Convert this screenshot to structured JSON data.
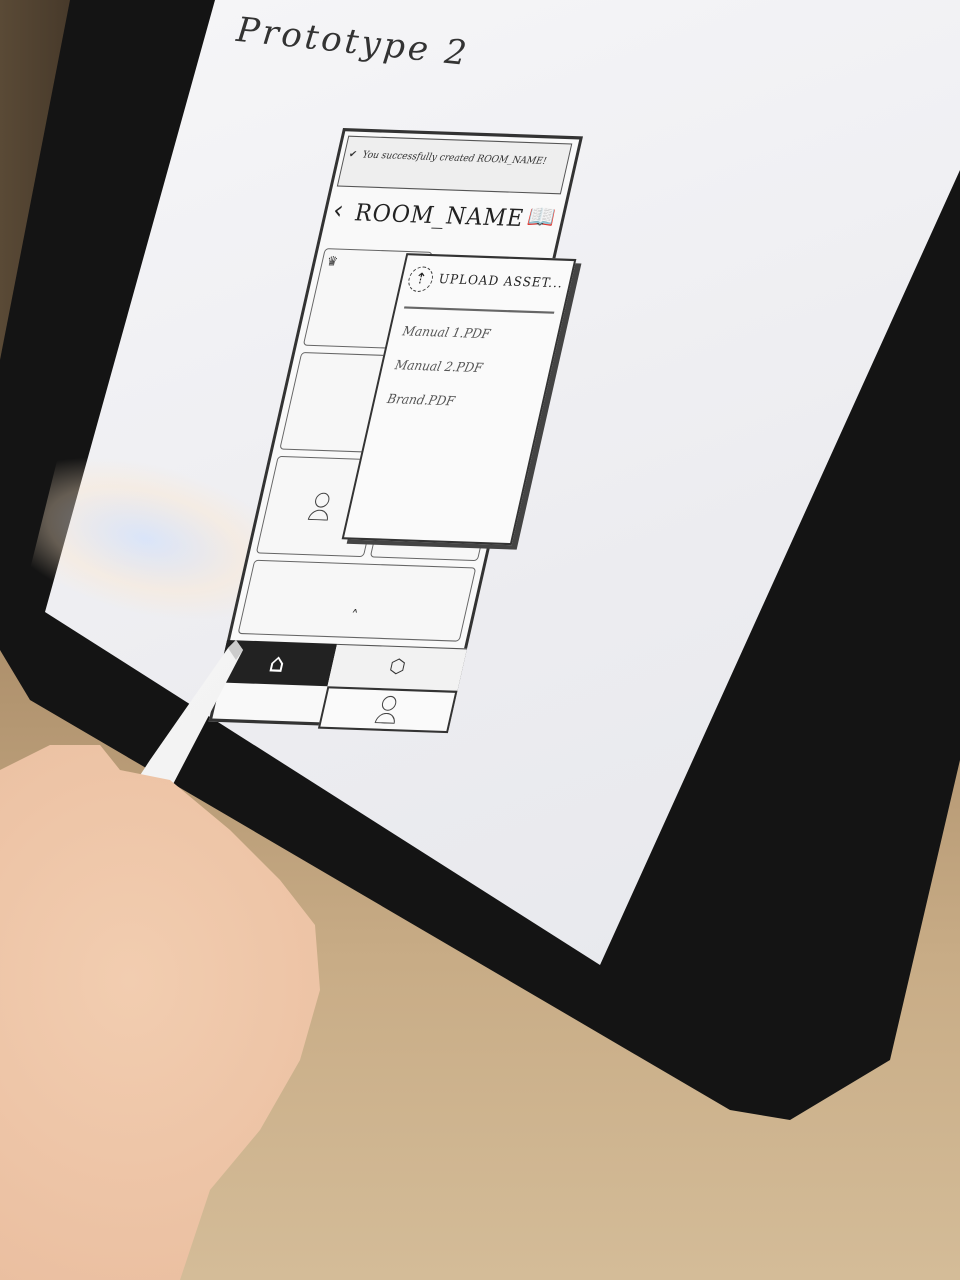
{
  "sketch": {
    "title": "Prototype 2",
    "toast": "You successfully created ROOM_NAME!",
    "room_title": "ROOM_NAME",
    "upload_label": "UPLOAD ASSET...",
    "files": [
      "Manual 1.PDF",
      "Manual 2.PDF",
      "Brand.PDF"
    ],
    "icons": [
      "check-icon",
      "back-icon",
      "book-icon",
      "crown-icon",
      "upload-icon",
      "chevron-up-icon",
      "home-icon",
      "box-icon",
      "person-icon"
    ]
  }
}
